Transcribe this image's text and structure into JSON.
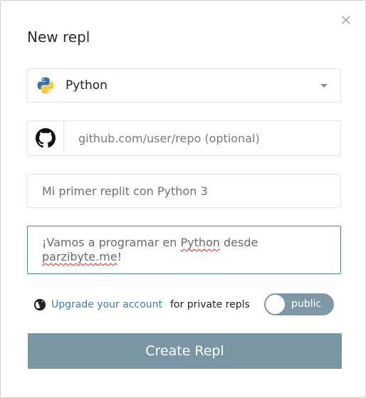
{
  "modal": {
    "title": "New repl",
    "close_symbol": "×"
  },
  "language": {
    "selected": "Python",
    "icon": "python-logo-icon"
  },
  "github": {
    "icon": "github-icon",
    "placeholder": "github.com/user/repo (optional)",
    "value": ""
  },
  "name": {
    "placeholder": "Mi primer replit con Python 3",
    "value": ""
  },
  "description": {
    "part1": "¡Vamos a programar en ",
    "part2": "Python",
    "part3": " desde ",
    "part4": "parzibyte.me",
    "part5": "!"
  },
  "privacy": {
    "icon": "globe-icon",
    "upgrade_link": "Upgrade your account",
    "suffix": "for private repls",
    "toggle_label": "public"
  },
  "actions": {
    "create_label": "Create Repl"
  },
  "colors": {
    "accent": "#3f7bb1",
    "button": "#7a95a3",
    "toggle": "#7e98a6",
    "focus_border": "#4a7fa0"
  }
}
